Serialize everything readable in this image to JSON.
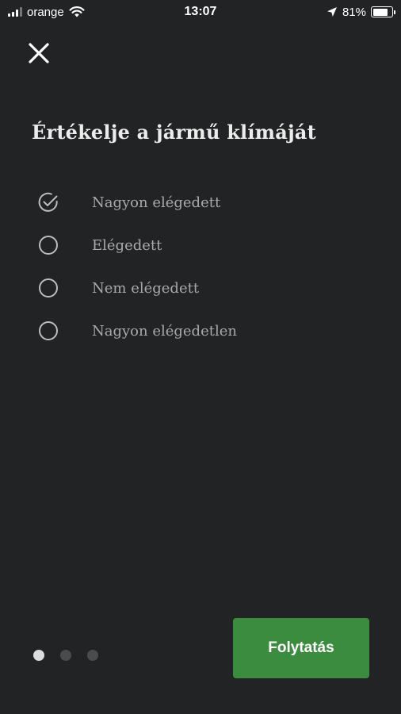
{
  "status_bar": {
    "carrier": "orange",
    "time": "13:07",
    "battery_percent": "81%",
    "battery_level": 0.81,
    "icons": [
      "signal-icon",
      "wifi-icon",
      "location-arrow-icon",
      "battery-icon"
    ]
  },
  "header": {
    "close_icon": "close-icon"
  },
  "title": "Értékelje a jármű klímáját",
  "options": [
    {
      "label": "Nagyon elégedett",
      "selected": true
    },
    {
      "label": "Elégedett",
      "selected": false
    },
    {
      "label": "Nem elégedett",
      "selected": false
    },
    {
      "label": "Nagyon elégedetlen",
      "selected": false
    }
  ],
  "pagination": {
    "total": 3,
    "current": 1
  },
  "cta": {
    "label": "Folytatás"
  },
  "colors": {
    "background": "#222325",
    "accent": "#3c8c3f",
    "option_text": "#a9a9a9"
  }
}
